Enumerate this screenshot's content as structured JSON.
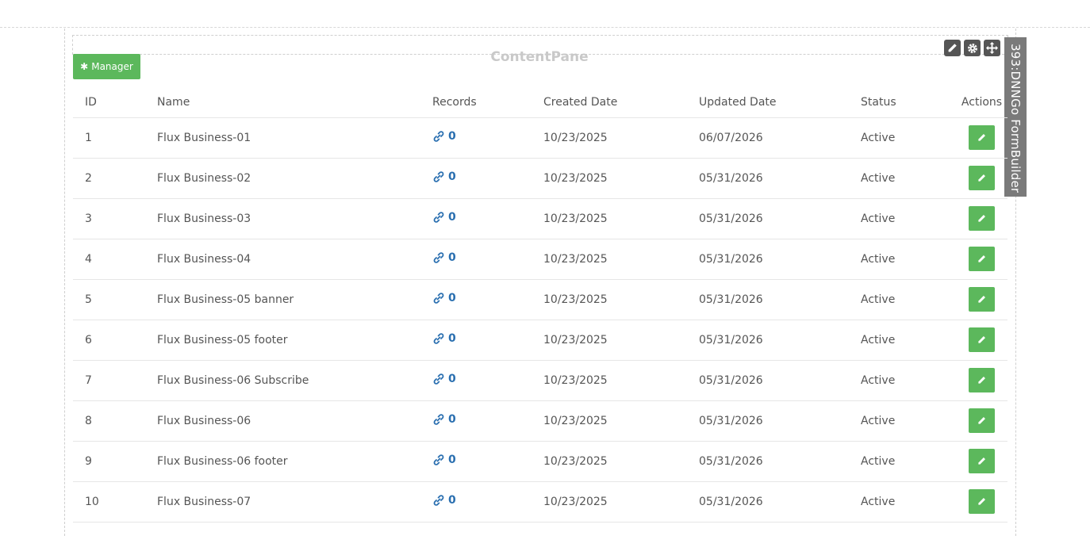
{
  "pane": {
    "title": "ContentPane",
    "module_tab": "393:DNNGo FormBuilder",
    "manager_label": "Manager",
    "icons": [
      "pencil-icon",
      "gear-icon",
      "move-icon"
    ]
  },
  "table": {
    "headers": {
      "id": "ID",
      "name": "Name",
      "records": "Records",
      "created": "Created Date",
      "updated": "Updated Date",
      "status": "Status",
      "actions": "Actions"
    },
    "rows": [
      {
        "id": "1",
        "name": "Flux Business-01",
        "records": "0",
        "created": "10/23/2025",
        "updated": "06/07/2026",
        "status": "Active"
      },
      {
        "id": "2",
        "name": "Flux Business-02",
        "records": "0",
        "created": "10/23/2025",
        "updated": "05/31/2026",
        "status": "Active"
      },
      {
        "id": "3",
        "name": "Flux Business-03",
        "records": "0",
        "created": "10/23/2025",
        "updated": "05/31/2026",
        "status": "Active"
      },
      {
        "id": "4",
        "name": "Flux Business-04",
        "records": "0",
        "created": "10/23/2025",
        "updated": "05/31/2026",
        "status": "Active"
      },
      {
        "id": "5",
        "name": "Flux Business-05 banner",
        "records": "0",
        "created": "10/23/2025",
        "updated": "05/31/2026",
        "status": "Active"
      },
      {
        "id": "6",
        "name": "Flux Business-05 footer",
        "records": "0",
        "created": "10/23/2025",
        "updated": "05/31/2026",
        "status": "Active"
      },
      {
        "id": "7",
        "name": "Flux Business-06 Subscribe",
        "records": "0",
        "created": "10/23/2025",
        "updated": "05/31/2026",
        "status": "Active"
      },
      {
        "id": "8",
        "name": "Flux Business-06",
        "records": "0",
        "created": "10/23/2025",
        "updated": "05/31/2026",
        "status": "Active"
      },
      {
        "id": "9",
        "name": "Flux Business-06 footer",
        "records": "0",
        "created": "10/23/2025",
        "updated": "05/31/2026",
        "status": "Active"
      },
      {
        "id": "10",
        "name": "Flux Business-07",
        "records": "0",
        "created": "10/23/2025",
        "updated": "05/31/2026",
        "status": "Active"
      }
    ]
  },
  "colors": {
    "accent_green": "#5cb85c",
    "link_blue": "#2a6fb0",
    "tab_gray": "#7a7a7a"
  }
}
